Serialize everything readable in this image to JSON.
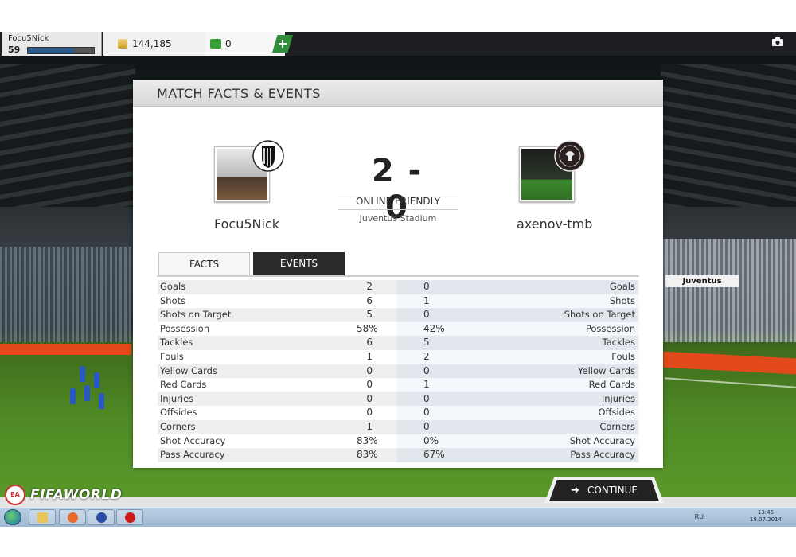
{
  "user": {
    "name": "Focu5Nick",
    "level": "59",
    "xp_progress": 0.7
  },
  "currency": {
    "coins": "144,185",
    "points": "0"
  },
  "panel": {
    "title": "MATCH FACTS & EVENTS"
  },
  "match": {
    "score": "2 - 0",
    "type": "ONLINE FRIENDLY",
    "stadium": "Juventus Stadium",
    "home_name": "Focu5Nick",
    "away_name": "axenov-tmb"
  },
  "tabs": {
    "facts": "FACTS",
    "events": "EVENTS"
  },
  "stats": [
    {
      "label": "Goals",
      "home": "2",
      "away": "0"
    },
    {
      "label": "Shots",
      "home": "6",
      "away": "1"
    },
    {
      "label": "Shots on Target",
      "home": "5",
      "away": "0"
    },
    {
      "label": "Possession",
      "home": "58%",
      "away": "42%"
    },
    {
      "label": "Tackles",
      "home": "6",
      "away": "5"
    },
    {
      "label": "Fouls",
      "home": "1",
      "away": "2"
    },
    {
      "label": "Yellow Cards",
      "home": "0",
      "away": "0"
    },
    {
      "label": "Red Cards",
      "home": "0",
      "away": "1"
    },
    {
      "label": "Injuries",
      "home": "0",
      "away": "0"
    },
    {
      "label": "Offsides",
      "home": "0",
      "away": "0"
    },
    {
      "label": "Corners",
      "home": "1",
      "away": "0"
    },
    {
      "label": "Shot Accuracy",
      "home": "83%",
      "away": "0%"
    },
    {
      "label": "Pass Accuracy",
      "home": "83%",
      "away": "67%"
    }
  ],
  "buttons": {
    "continue": "CONTINUE",
    "add_points": "+"
  },
  "stadium_board": "Juventus",
  "brand": {
    "fifa_text": "FIFAWORLD",
    "ea_badge": "EA"
  },
  "taskbar": {
    "language": "RU",
    "time": "13:45",
    "date": "18.07.2014"
  },
  "colors": {
    "accent_green": "#35a034",
    "dark_tab": "#2a2a2a",
    "ad_orange": "#e34a1b"
  },
  "icons": [
    "coin-icon",
    "points-icon",
    "add-icon",
    "camera-icon",
    "arrow-right-icon",
    "windows-start-icon",
    "explorer-icon",
    "chrome-icon",
    "fifa-world-icon",
    "opera-icon"
  ]
}
